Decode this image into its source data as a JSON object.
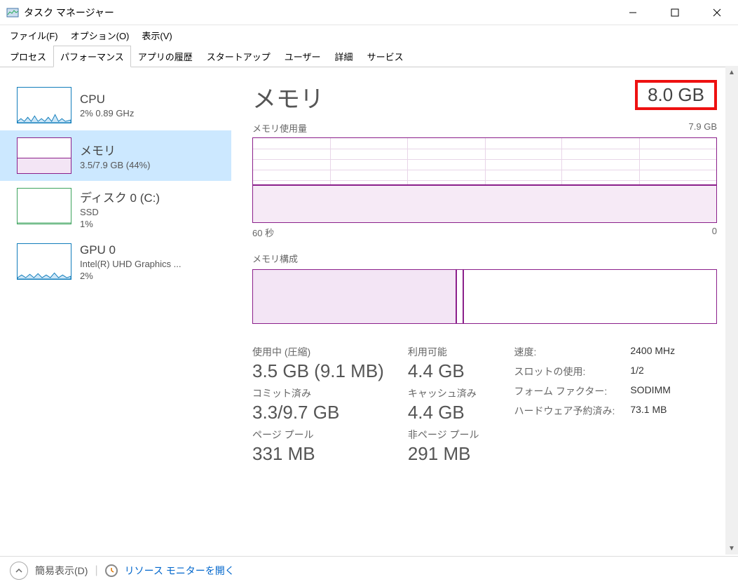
{
  "window": {
    "title": "タスク マネージャー"
  },
  "menu": {
    "file": "ファイル(F)",
    "options": "オプション(O)",
    "view": "表示(V)"
  },
  "tabs": [
    "プロセス",
    "パフォーマンス",
    "アプリの履歴",
    "スタートアップ",
    "ユーザー",
    "詳細",
    "サービス"
  ],
  "sidebar": [
    {
      "name": "CPU",
      "sub": "2%  0.89 GHz"
    },
    {
      "name": "メモリ",
      "sub": "3.5/7.9 GB (44%)"
    },
    {
      "name": "ディスク 0 (C:)",
      "sub": "SSD",
      "sub2": "1%"
    },
    {
      "name": "GPU 0",
      "sub": "Intel(R) UHD Graphics ...",
      "sub2": "2%"
    }
  ],
  "main": {
    "title": "メモリ",
    "total": "8.0 GB",
    "usage_label": "メモリ使用量",
    "usage_max": "7.9 GB",
    "axis_left": "60 秒",
    "axis_right": "0",
    "composition_label": "メモリ構成",
    "stats": {
      "in_use_label": "使用中 (圧縮)",
      "in_use_value": "3.5 GB (9.1 MB)",
      "available_label": "利用可能",
      "available_value": "4.4 GB",
      "committed_label": "コミット済み",
      "committed_value": "3.3/9.7 GB",
      "cached_label": "キャッシュ済み",
      "cached_value": "4.4 GB",
      "paged_label": "ページ プール",
      "paged_value": "331 MB",
      "nonpaged_label": "非ページ プール",
      "nonpaged_value": "291 MB"
    },
    "specs": {
      "speed_k": "速度:",
      "speed_v": "2400 MHz",
      "slots_k": "スロットの使用:",
      "slots_v": "1/2",
      "form_k": "フォーム ファクター:",
      "form_v": "SODIMM",
      "reserved_k": "ハードウェア予約済み:",
      "reserved_v": "73.1 MB"
    }
  },
  "footer": {
    "collapse": "簡易表示(D)",
    "resource": "リソース モニターを開く"
  },
  "chart_data": {
    "type": "area",
    "title": "メモリ使用量",
    "xlabel": "60 秒 → 0",
    "ylabel": "GB",
    "ylim": [
      0,
      7.9
    ],
    "x": [
      60,
      55,
      50,
      45,
      40,
      35,
      30,
      25,
      20,
      15,
      10,
      5,
      0
    ],
    "values": [
      3.5,
      3.5,
      3.5,
      3.5,
      3.5,
      3.5,
      3.5,
      3.5,
      3.5,
      3.5,
      3.5,
      3.5,
      3.5
    ],
    "composition": {
      "in_use_gb": 3.5,
      "modified_gb": 0.1,
      "standby_gb": 4.3,
      "free_gb": 0.0,
      "total_gb": 7.9
    }
  }
}
